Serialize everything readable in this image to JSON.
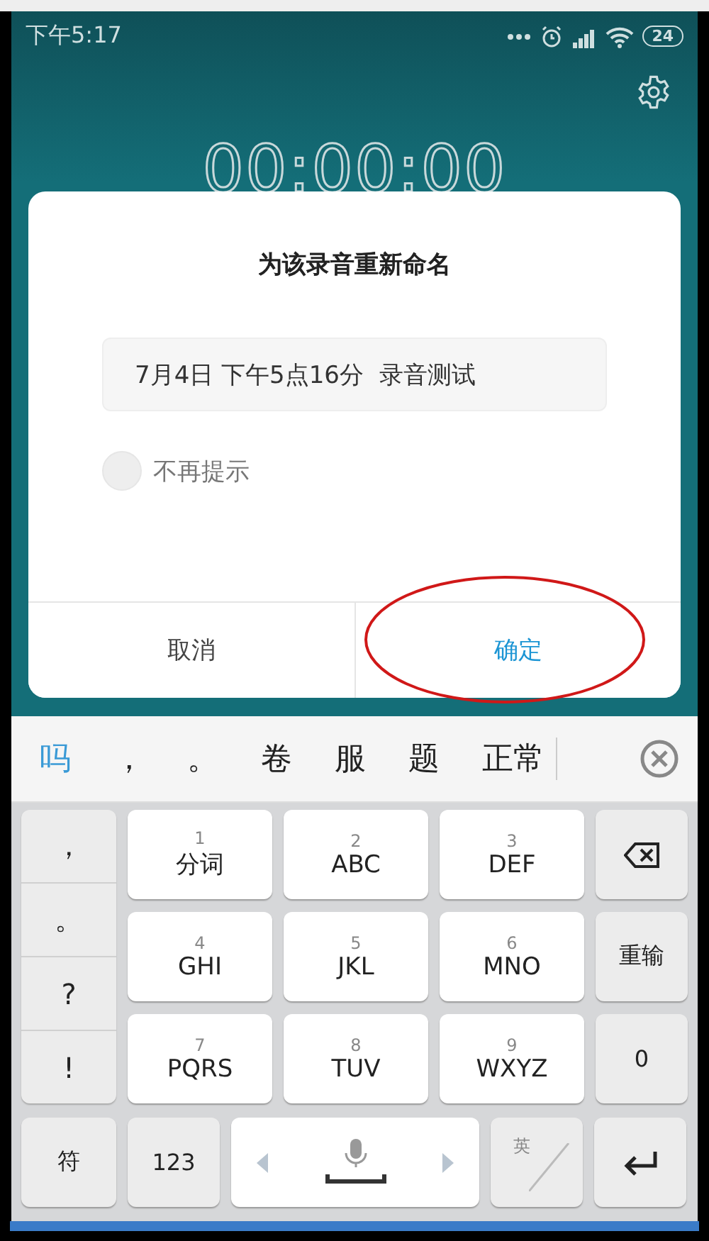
{
  "status_bar": {
    "time": "下午5:17",
    "battery": "24"
  },
  "timer": "00:00:00",
  "dialog": {
    "title": "为该录音重新命名",
    "name_field": {
      "value": "7月4日 下午5点16分  录音测试"
    },
    "checkbox": {
      "label": "不再提示",
      "checked": false
    },
    "buttons": [
      {
        "label": "取消",
        "kind": "cancel",
        "circled": false
      },
      {
        "label": "确定",
        "kind": "confirm",
        "circled": true
      }
    ]
  },
  "candidates": [
    {
      "text": "吗",
      "selected": true
    },
    {
      "text": "，",
      "selected": false
    },
    {
      "text": "。",
      "selected": false
    },
    {
      "text": "卷",
      "selected": false
    },
    {
      "text": "服",
      "selected": false
    },
    {
      "text": "题",
      "selected": false
    },
    {
      "text": "正常",
      "selected": false
    }
  ],
  "keyboard": {
    "symbols": [
      "，",
      "。",
      "?",
      "!"
    ],
    "keys": [
      {
        "number": "1",
        "label": "分词"
      },
      {
        "number": "2",
        "label": "ABC"
      },
      {
        "number": "3",
        "label": "DEF"
      },
      {
        "number": "4",
        "label": "GHI"
      },
      {
        "number": "5",
        "label": "JKL"
      },
      {
        "number": "6",
        "label": "MNO"
      },
      {
        "number": "7",
        "label": "PQRS"
      },
      {
        "number": "8",
        "label": "TUV"
      },
      {
        "number": "9",
        "label": "WXYZ"
      }
    ],
    "side_keys": [
      {
        "kind": "backspace"
      },
      {
        "kind": "text",
        "label": "重输"
      },
      {
        "kind": "text",
        "label": "0"
      }
    ],
    "bottom_row": [
      {
        "kind": "text",
        "label": "符"
      },
      {
        "kind": "text",
        "label": "123"
      },
      {
        "kind": "space"
      },
      {
        "kind": "lang",
        "label": "英"
      },
      {
        "kind": "enter"
      }
    ]
  }
}
